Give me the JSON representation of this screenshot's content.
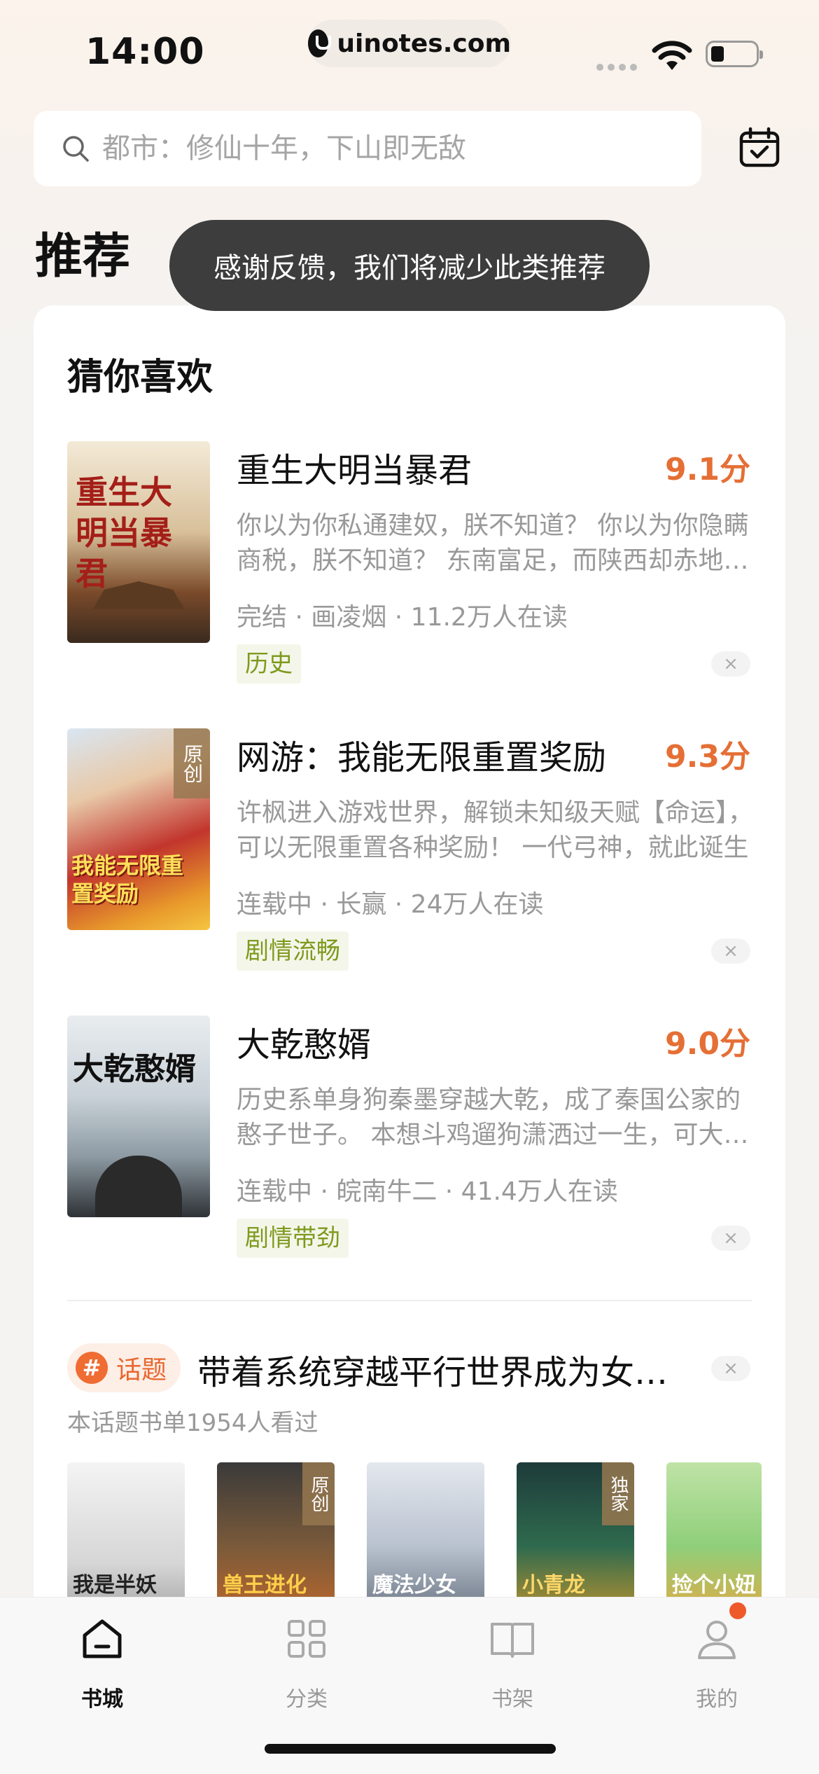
{
  "status_bar": {
    "time": "14:00",
    "url": "uinotes.com"
  },
  "search": {
    "placeholder": "都市：修仙十年，下山即无敌"
  },
  "section_title": "推荐",
  "toast": "感谢反馈，我们将减少此类推荐",
  "card": {
    "title": "猜你喜欢",
    "books": [
      {
        "title": "重生大明当暴君",
        "score": "9.1分",
        "desc": "你以为你私通建奴，朕不知道？ 你以为你隐瞒商税，朕不知道？ 东南富足，而陕西却赤地千里",
        "meta": "完结 · 画凌烟 · 11.2万人在读",
        "tag": "历史",
        "cover_text": "重生大明当暴君",
        "badge": ""
      },
      {
        "title": "网游：我能无限重置奖励",
        "score": "9.3分",
        "desc": "许枫进入游戏世界，解锁未知级天赋【命运】，可以无限重置各种奖励！ 一代弓神，就此诞生",
        "meta": "连载中 · 长赢 · 24万人在读",
        "tag": "剧情流畅",
        "cover_text": "我能无限重置奖励",
        "badge": "原创"
      },
      {
        "title": "大乾憨婿",
        "score": "9.0分",
        "desc": "历史系单身狗秦墨穿越大乾，成了秦国公家的憨子世子。 本想斗鸡遛狗潇洒过一生，可大乾风云",
        "meta": "连载中 · 皖南牛二 · 41.4万人在读",
        "tag": "剧情带劲",
        "cover_text": "大乾憨婿",
        "badge": ""
      }
    ],
    "close_glyph": "×",
    "topic": {
      "pill_hash": "#",
      "pill_label": "话题",
      "title": "带着系统穿越平行世界成为女明星",
      "subtitle": "本话题书单1954人看过",
      "covers": [
        {
          "text": "我是半妖",
          "badge": ""
        },
        {
          "text": "兽王进化",
          "badge": "原创"
        },
        {
          "text": "魔法少女",
          "badge": ""
        },
        {
          "text": "小青龙",
          "badge": "独家"
        },
        {
          "text": "捡个小妞",
          "badge": ""
        }
      ]
    }
  },
  "tabs": [
    {
      "label": "书城",
      "icon": "home-icon",
      "active": true
    },
    {
      "label": "分类",
      "icon": "grid-icon",
      "active": false
    },
    {
      "label": "书架",
      "icon": "book-icon",
      "active": false
    },
    {
      "label": "我的",
      "icon": "person-icon",
      "active": false
    }
  ],
  "colors": {
    "accent": "#e56f35",
    "tag_text": "#7e9a1d",
    "toast_bg": "#3d3d3d"
  }
}
